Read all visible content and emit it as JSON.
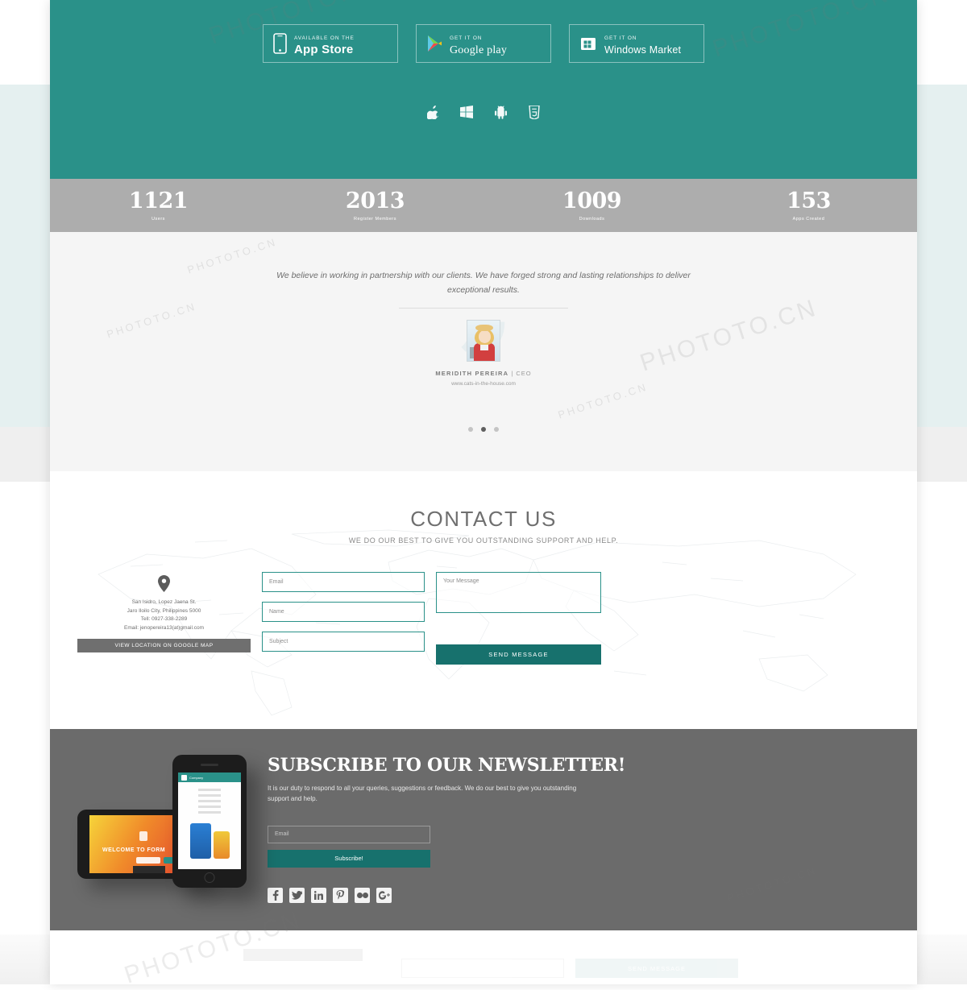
{
  "theme": {
    "teal": "#2a9189",
    "teal_dark": "#17716d",
    "stats_gray": "#adadad",
    "newsletter_gray": "#6b6b6b",
    "light_gray": "#f5f5f5"
  },
  "hero": {
    "store_badges": [
      {
        "icon": "iphone-icon",
        "sup": "AVAILABLE ON THE",
        "main": "App Store",
        "style": "bold"
      },
      {
        "icon": "google-play-icon",
        "sup": "GET IT ON",
        "main": "Google play",
        "style": "serif"
      },
      {
        "icon": "windows-store-icon",
        "sup": "GET IT ON",
        "main": "Windows Market",
        "style": "small"
      }
    ],
    "platform_icons": [
      "apple-icon",
      "windows-icon",
      "android-icon",
      "html5-icon"
    ]
  },
  "stats": [
    {
      "number": "1121",
      "label": "Users"
    },
    {
      "number": "2013",
      "label": "Register Members"
    },
    {
      "number": "1009",
      "label": "Downloads"
    },
    {
      "number": "153",
      "label": "Apps Created"
    }
  ],
  "testimonial": {
    "quote": "We believe in working in partnership with our clients. We have forged strong and lasting relationships to deliver exceptional results.",
    "quote_mark": "”",
    "author_name": "MERIDITH PEREIRA",
    "author_separator": " | ",
    "author_role": "CEO",
    "author_url": "www.cats-in-the-house.com",
    "carousel_dots": 3,
    "active_dot_index": 1
  },
  "contact": {
    "heading": "CONTACT US",
    "subheading": "WE DO OUR BEST TO GIVE YOU OUTSTANDING SUPPORT AND HELP.",
    "address_lines": [
      "San Isidro, Lopez Jaena St.",
      "Jaro Iloilo City, Philippines 5000",
      "Tell: 0927-338-2289",
      "Email: jenopereira13(at)gmail.com"
    ],
    "map_button": "VIEW LOCATION ON GOOGLE MAP",
    "fields": [
      {
        "name": "email",
        "placeholder": "Email"
      },
      {
        "name": "name",
        "placeholder": "Name"
      },
      {
        "name": "subject",
        "placeholder": "Subject"
      }
    ],
    "message_placeholder": "Your Message",
    "send_button": "SEND MESSAGE"
  },
  "newsletter": {
    "heading": "SUBSCRIBE TO OUR NEWSLETTER!",
    "paragraph": "It is our duty to respond to all your queries, suggestions or feedback. We do our best to give you outstanding support and help.",
    "email_placeholder": "Email",
    "subscribe_button": "Subscribe!",
    "socials": [
      "facebook-icon",
      "twitter-icon",
      "linkedin-icon",
      "pinterest-icon",
      "flickr-icon",
      "google-plus-icon"
    ],
    "phone_mockups": {
      "landscape_text": "WELCOME TO FORM",
      "portrait_app_name": "Company"
    }
  },
  "footer_repeat": {
    "send_button": "SEND MESSAGE"
  },
  "watermarks": {
    "text": "PHOTOTO.CN"
  }
}
